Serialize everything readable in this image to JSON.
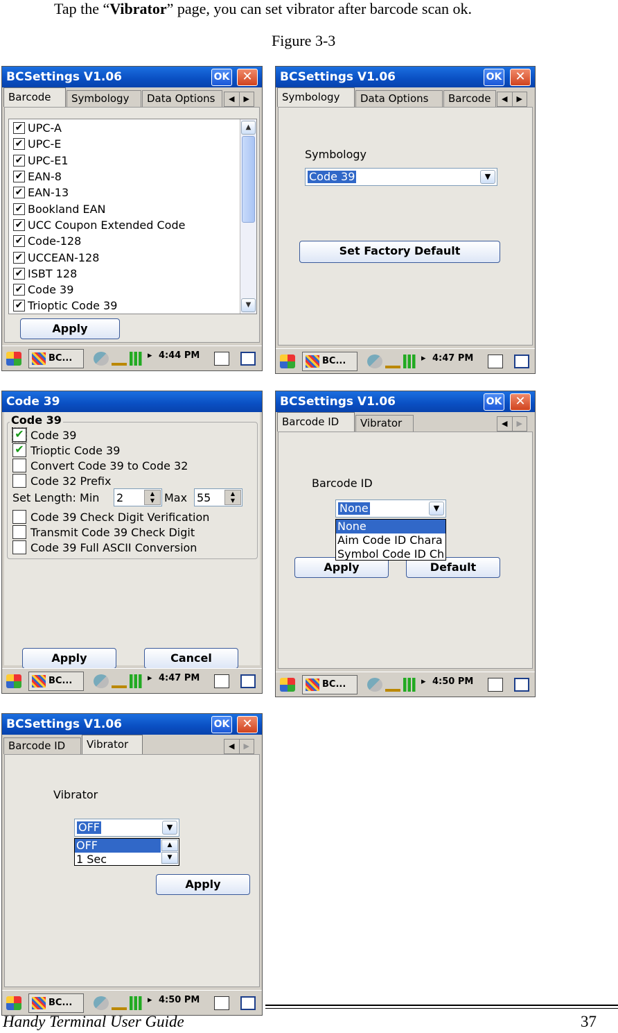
{
  "intro": {
    "prefix": "Tap the “",
    "bold": "Vibrator",
    "suffix": "” page, you can set vibrator after barcode scan ok."
  },
  "figure_caption": "Figure 3-3",
  "common": {
    "app_title": "BCSettings V1.06",
    "ok_label": "OK",
    "close_label": "✕",
    "start_label": "BC...",
    "arrow_left": "◀",
    "arrow_right": "▶"
  },
  "screen1": {
    "tabs": [
      "Barcode",
      "Symbology",
      "Data Options"
    ],
    "items": [
      "UPC-A",
      "UPC-E",
      "UPC-E1",
      "EAN-8",
      "EAN-13",
      "Bookland EAN",
      "UCC Coupon Extended Code",
      "Code-128",
      "UCCEAN-128",
      "ISBT 128",
      "Code 39",
      "Trioptic Code 39"
    ],
    "apply_label": "Apply",
    "clock": "4:44 PM"
  },
  "screen2": {
    "tabs": [
      "Symbology",
      "Data Options",
      "Barcode"
    ],
    "symbology_label": "Symbology",
    "symbology_value": "Code 39",
    "factory_label": "Set Factory Default",
    "clock": "4:47 PM"
  },
  "screen3": {
    "title": "Code 39",
    "group_title": "Code 39",
    "options": [
      {
        "label": "Code 39",
        "checked": true
      },
      {
        "label": "Trioptic Code 39",
        "checked": true
      },
      {
        "label": "Convert Code 39 to Code 32",
        "checked": false
      },
      {
        "label": "Code 32 Prefix",
        "checked": false
      }
    ],
    "length_label": "Set Length: Min",
    "min_value": "2",
    "max_label": "Max",
    "max_value": "55",
    "options2": [
      {
        "label": "Code 39 Check Digit Verification",
        "checked": false
      },
      {
        "label": "Transmit Code 39 Check Digit",
        "checked": false
      },
      {
        "label": "Code 39 Full ASCII Conversion",
        "checked": false
      }
    ],
    "apply_label": "Apply",
    "cancel_label": "Cancel",
    "clock": "4:47 PM"
  },
  "screen4": {
    "tabs": [
      "Barcode ID",
      "Vibrator"
    ],
    "barcode_id_label": "Barcode ID",
    "combo_value": "None",
    "dropdown": [
      "None",
      "Aim Code ID Chara",
      "Symbol Code ID Ch"
    ],
    "apply_label": "Apply",
    "default_label": "Default",
    "clock": "4:50 PM"
  },
  "screen5": {
    "tabs": [
      "Barcode ID",
      "Vibrator"
    ],
    "vibrator_label": "Vibrator",
    "combo_value": "OFF",
    "dropdown": [
      "OFF",
      "1 Sec"
    ],
    "apply_label": "Apply",
    "clock": "4:50 PM"
  },
  "footer": {
    "title": "Handy Terminal User Guide",
    "page": "37"
  }
}
